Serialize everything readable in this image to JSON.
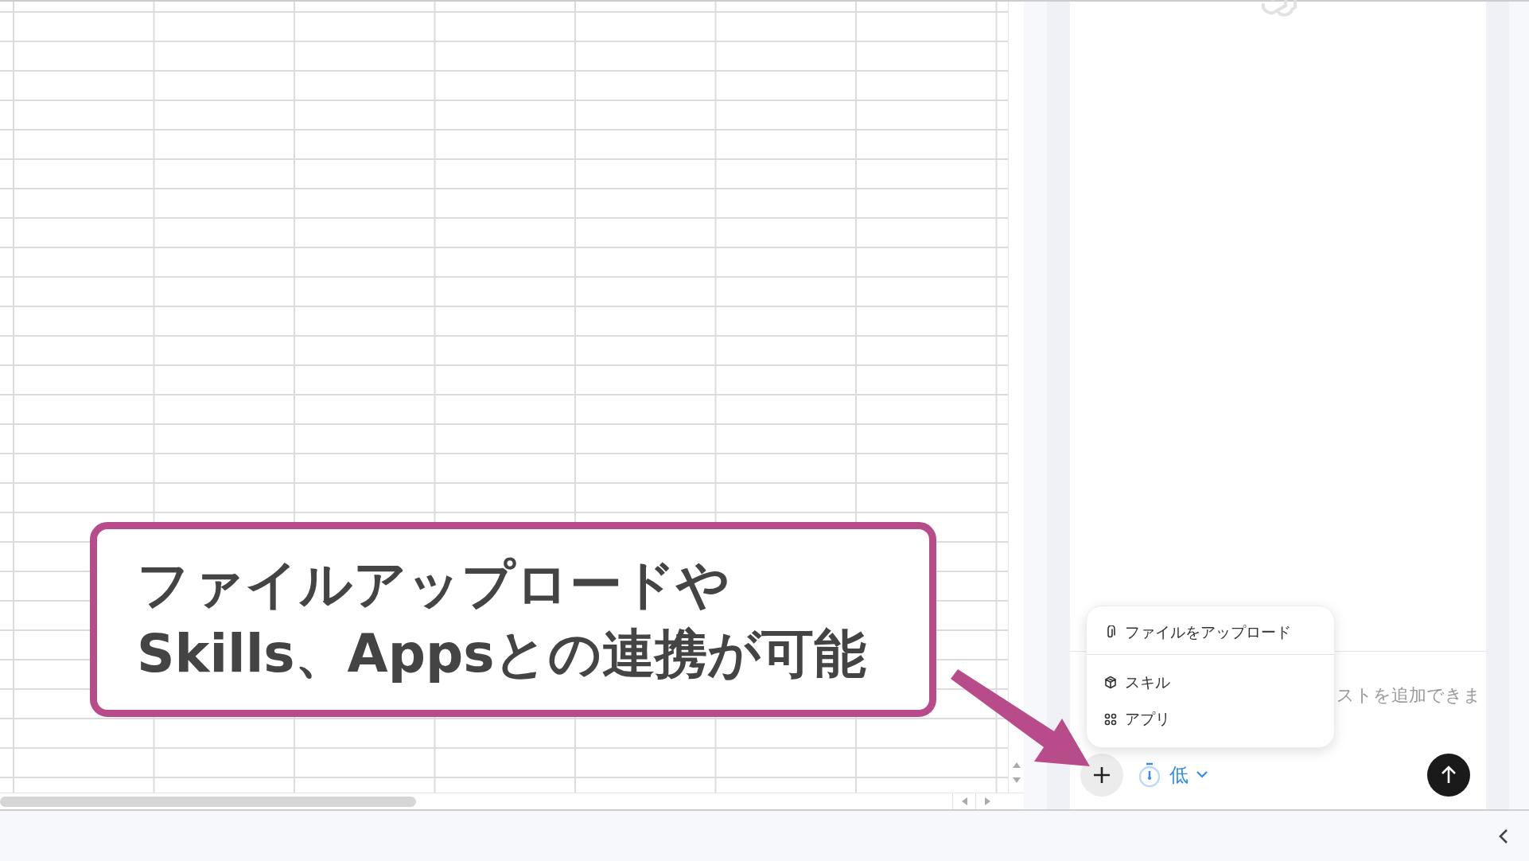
{
  "callout": {
    "lines": [
      "ファイルアップロードや",
      "Skills、Appsとの連携が可能"
    ]
  },
  "composer": {
    "placeholder": "ストを追加できま",
    "effort": "低"
  },
  "menu": {
    "sections": [
      [
        {
          "label": "ファイルをアップロード",
          "kind": "attach"
        }
      ],
      [
        {
          "label": "スキル",
          "kind": "skill"
        },
        {
          "label": "アプリ",
          "kind": "apps"
        }
      ]
    ]
  }
}
